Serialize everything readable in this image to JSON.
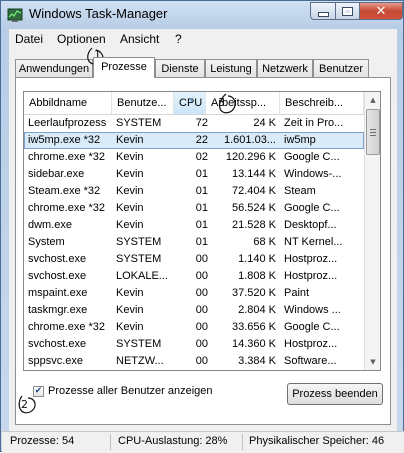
{
  "window": {
    "title": "Windows Task-Manager"
  },
  "menu": [
    "Datei",
    "Optionen",
    "Ansicht",
    "?"
  ],
  "tabs": [
    "Anwendungen",
    "Prozesse",
    "Dienste",
    "Leistung",
    "Netzwerk",
    "Benutzer"
  ],
  "active_tab": "Prozesse",
  "columns": [
    "Abbildname",
    "Benutze...",
    "CPU",
    "Arbeitssp...",
    "Beschreib..."
  ],
  "sorted_column": "CPU",
  "rows": [
    {
      "name": "Leerlaufprozess",
      "user": "SYSTEM",
      "cpu": "72",
      "mem": "24 K",
      "desc": "Zeit in Pro..."
    },
    {
      "name": "iw5mp.exe *32",
      "user": "Kevin",
      "cpu": "22",
      "mem": "1.601.03...",
      "desc": "iw5mp"
    },
    {
      "name": "chrome.exe *32",
      "user": "Kevin",
      "cpu": "02",
      "mem": "120.296 K",
      "desc": "Google C..."
    },
    {
      "name": "sidebar.exe",
      "user": "Kevin",
      "cpu": "01",
      "mem": "13.144 K",
      "desc": "Windows-..."
    },
    {
      "name": "Steam.exe *32",
      "user": "Kevin",
      "cpu": "01",
      "mem": "72.404 K",
      "desc": "Steam"
    },
    {
      "name": "chrome.exe *32",
      "user": "Kevin",
      "cpu": "01",
      "mem": "56.524 K",
      "desc": "Google C..."
    },
    {
      "name": "dwm.exe",
      "user": "Kevin",
      "cpu": "01",
      "mem": "21.528 K",
      "desc": "Desktopf..."
    },
    {
      "name": "System",
      "user": "SYSTEM",
      "cpu": "01",
      "mem": "68 K",
      "desc": "NT Kernel..."
    },
    {
      "name": "svchost.exe",
      "user": "SYSTEM",
      "cpu": "00",
      "mem": "1.140 K",
      "desc": "Hostproz..."
    },
    {
      "name": "svchost.exe",
      "user": "LOKALE...",
      "cpu": "00",
      "mem": "1.808 K",
      "desc": "Hostproz..."
    },
    {
      "name": "mspaint.exe",
      "user": "Kevin",
      "cpu": "00",
      "mem": "37.520 K",
      "desc": "Paint"
    },
    {
      "name": "taskmgr.exe",
      "user": "Kevin",
      "cpu": "00",
      "mem": "2.804 K",
      "desc": "Windows ..."
    },
    {
      "name": "chrome.exe *32",
      "user": "Kevin",
      "cpu": "00",
      "mem": "33.656 K",
      "desc": "Google C..."
    },
    {
      "name": "svchost.exe",
      "user": "SYSTEM",
      "cpu": "00",
      "mem": "14.360 K",
      "desc": "Hostproz..."
    },
    {
      "name": "sppsvc.exe",
      "user": "NETZW...",
      "cpu": "00",
      "mem": "3.384 K",
      "desc": "Software..."
    }
  ],
  "selected_row": 1,
  "show_all_users": {
    "label": "Prozesse aller Benutzer anzeigen",
    "checked": true
  },
  "end_process_label": "Prozess beenden",
  "status": {
    "processes": "Prozesse: 54",
    "cpu": "CPU-Auslastung: 28%",
    "memory": "Physikalischer Speicher: 46"
  },
  "annotations": [
    "1",
    "2",
    "3"
  ]
}
